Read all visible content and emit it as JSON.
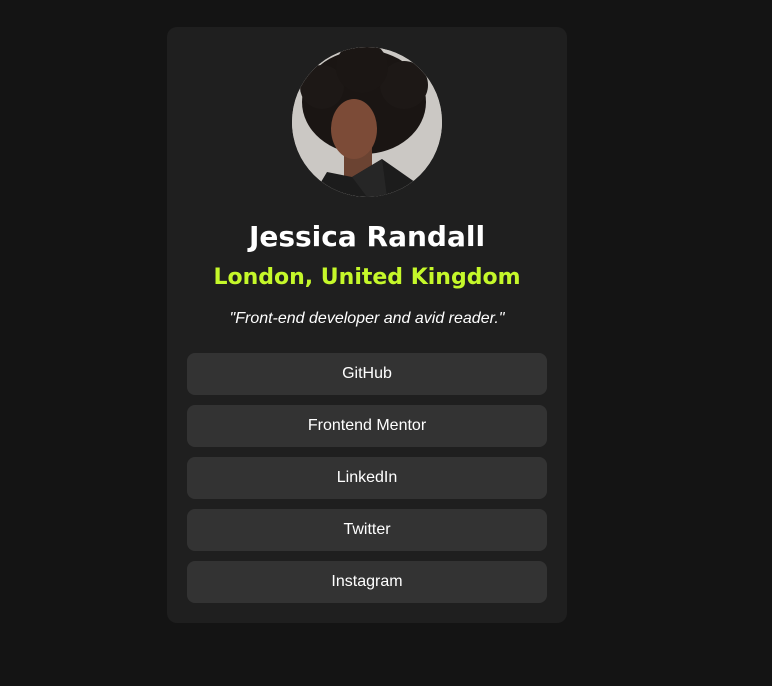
{
  "profile": {
    "name": "Jessica Randall",
    "location": "London, United Kingdom",
    "bio": "\"Front-end developer and avid reader.\""
  },
  "links": [
    {
      "label": "GitHub"
    },
    {
      "label": "Frontend Mentor"
    },
    {
      "label": "LinkedIn"
    },
    {
      "label": "Twitter"
    },
    {
      "label": "Instagram"
    }
  ],
  "colors": {
    "page_background": "#141414",
    "card_background": "#1f1f1f",
    "button_background": "#333333",
    "accent": "#c5f82a"
  }
}
